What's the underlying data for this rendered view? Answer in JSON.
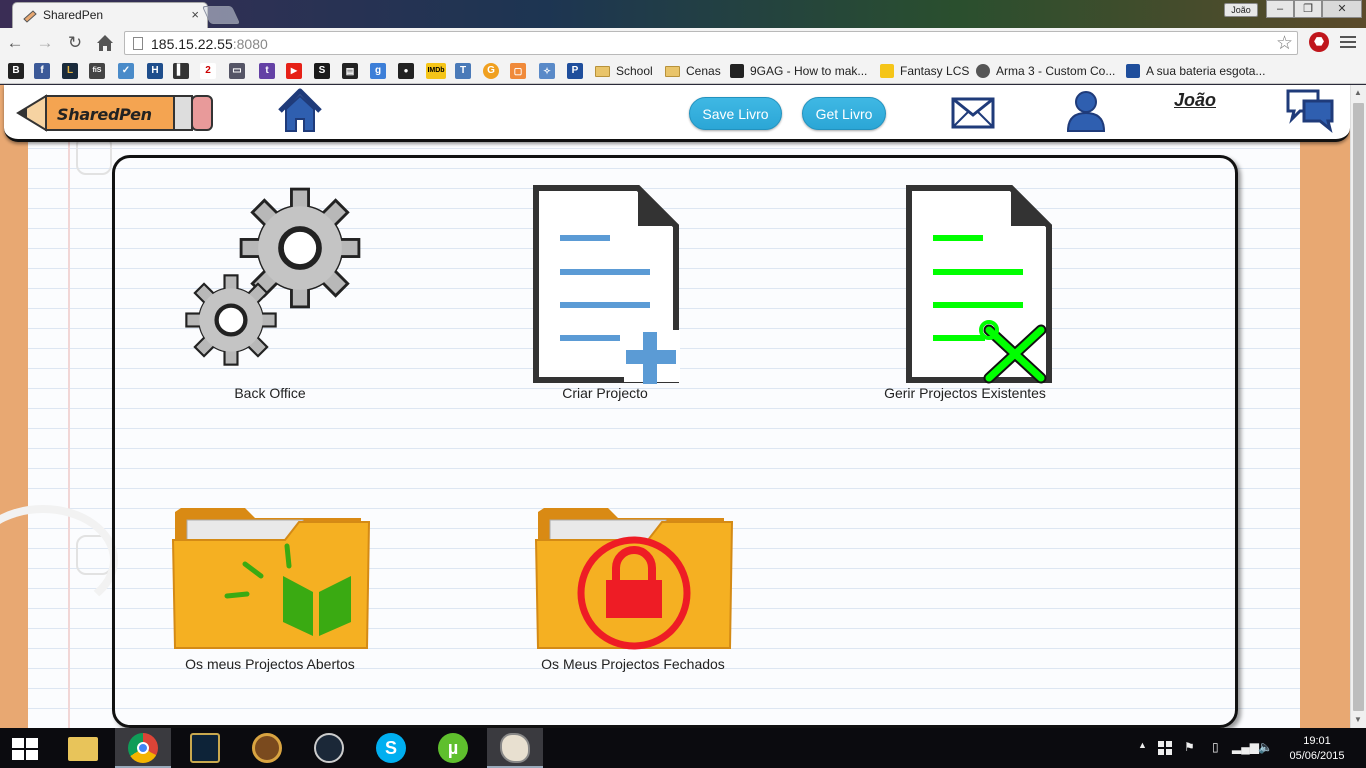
{
  "browser": {
    "tab_title": "SharedPen",
    "tab_close": "×",
    "window_user": "João",
    "window_buttons": [
      "–",
      "❐",
      "✕"
    ],
    "url_host": "185.15.22.55",
    "url_port": ":8080",
    "bookmarks": [
      {
        "label": "School",
        "type": "folder"
      },
      {
        "label": "Cenas",
        "type": "folder"
      },
      {
        "label": "9GAG - How to mak...",
        "type": "link"
      },
      {
        "label": "Fantasy LCS",
        "type": "link"
      },
      {
        "label": "Arma 3 - Custom Co...",
        "type": "link"
      },
      {
        "label": "A sua bateria esgota...",
        "type": "link"
      }
    ],
    "bookmark_icons": [
      "B",
      "f",
      "L",
      "fiS",
      "✓",
      "H",
      "▍",
      "2",
      "▭",
      "t",
      "▶",
      "S",
      "▤",
      "g",
      "●",
      "IMDb",
      "T",
      "G",
      "▢",
      "✧",
      "P"
    ]
  },
  "header": {
    "logo_text": "SharedPen",
    "save_button": "Save Livro",
    "get_button": "Get Livro",
    "user_name": "João"
  },
  "tiles": [
    {
      "label": "Back Office"
    },
    {
      "label": "Criar Projecto"
    },
    {
      "label": "Gerir Projectos Existentes"
    },
    {
      "label": "Os meus Projectos Abertos"
    },
    {
      "label": "Os Meus Projectos Fechados"
    }
  ],
  "taskbar": {
    "time": "19:01",
    "date": "05/06/2015"
  },
  "colors": {
    "accent": "#3fb8e4",
    "doc_blue": "#5b9bd5",
    "doc_green": "#00ff00",
    "folder": "#f5a623",
    "lock_red": "#ee1c25",
    "book_green": "#3aaa12"
  }
}
